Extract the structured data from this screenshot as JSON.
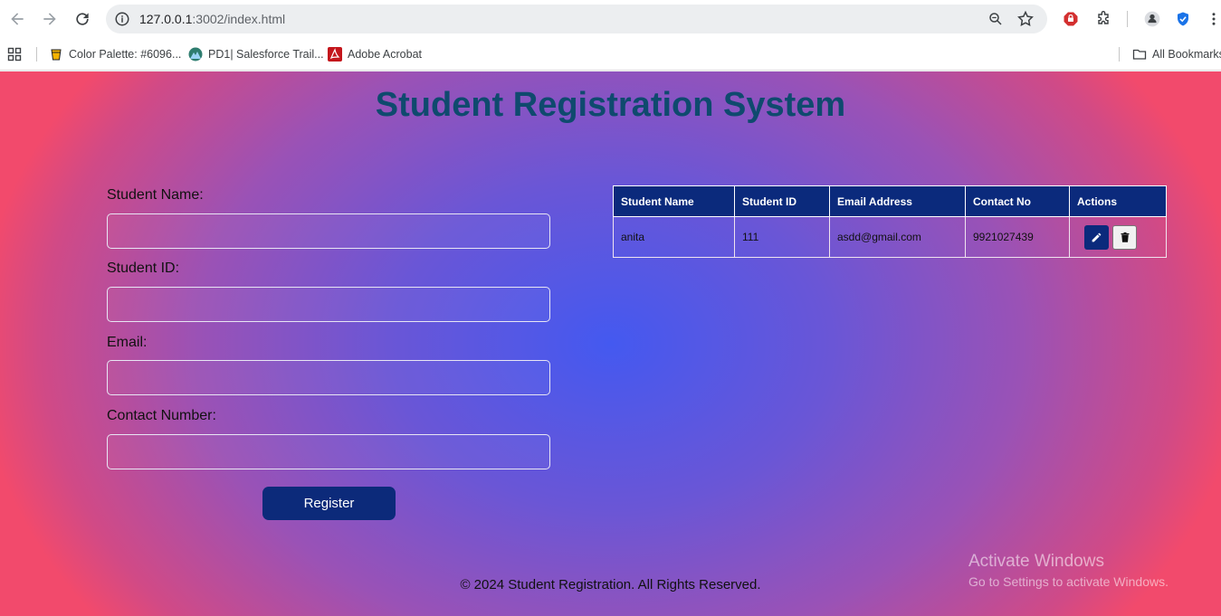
{
  "browser": {
    "url_host": "127.0.0.1",
    "url_rest": ":3002/index.html",
    "bookmarks": [
      {
        "label": "Color Palette: #6096..."
      },
      {
        "label": "PD1| Salesforce Trail..."
      },
      {
        "label": "Adobe Acrobat"
      }
    ],
    "all_bookmarks": "All Bookmarks"
  },
  "page": {
    "title": "Student Registration System",
    "form": {
      "name_label": "Student Name:",
      "id_label": "Student ID:",
      "email_label": "Email:",
      "contact_label": "Contact Number:",
      "name_value": "",
      "id_value": "",
      "email_value": "",
      "contact_value": "",
      "register_label": "Register"
    },
    "table": {
      "headers": [
        "Student Name",
        "Student ID",
        "Email Address",
        "Contact No",
        "Actions"
      ],
      "rows": [
        {
          "name": "anita",
          "id": "111",
          "email": "asdd@gmail.com",
          "contact": "9921027439"
        }
      ]
    },
    "footer": "© 2024 Student Registration. All Rights Reserved.",
    "watermark": {
      "line1": "Activate Windows",
      "line2": "Go to Settings to activate Windows."
    }
  }
}
